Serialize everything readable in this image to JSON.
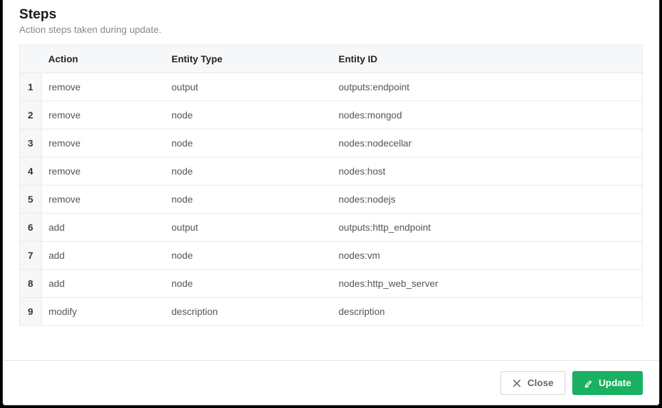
{
  "section": {
    "title": "Steps",
    "subtitle": "Action steps taken during update."
  },
  "columns": {
    "action": "Action",
    "entity_type": "Entity Type",
    "entity_id": "Entity ID"
  },
  "steps": [
    {
      "n": "1",
      "action": "remove",
      "type": "output",
      "id": "outputs:endpoint"
    },
    {
      "n": "2",
      "action": "remove",
      "type": "node",
      "id": "nodes:mongod"
    },
    {
      "n": "3",
      "action": "remove",
      "type": "node",
      "id": "nodes:nodecellar"
    },
    {
      "n": "4",
      "action": "remove",
      "type": "node",
      "id": "nodes:host"
    },
    {
      "n": "5",
      "action": "remove",
      "type": "node",
      "id": "nodes:nodejs"
    },
    {
      "n": "6",
      "action": "add",
      "type": "output",
      "id": "outputs:http_endpoint"
    },
    {
      "n": "7",
      "action": "add",
      "type": "node",
      "id": "nodes:vm"
    },
    {
      "n": "8",
      "action": "add",
      "type": "node",
      "id": "nodes:http_web_server"
    },
    {
      "n": "9",
      "action": "modify",
      "type": "description",
      "id": "description"
    }
  ],
  "buttons": {
    "close": "Close",
    "update": "Update"
  }
}
